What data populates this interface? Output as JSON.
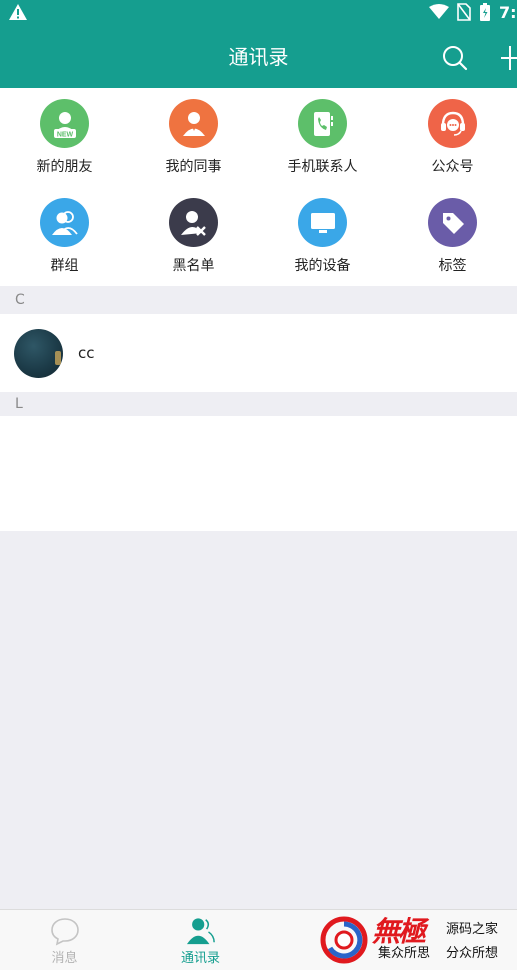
{
  "status_bar": {
    "time": "7:",
    "icons": [
      "warning-icon",
      "wifi-icon",
      "no-sim-icon",
      "battery-icon"
    ]
  },
  "header": {
    "title": "通讯录",
    "background": "#159e8f",
    "actions": [
      "search-icon",
      "plus-icon"
    ]
  },
  "features": [
    {
      "label": "新的朋友",
      "icon": "new-friend-icon",
      "color": "#5dbf6a",
      "badge": "NEW"
    },
    {
      "label": "我的同事",
      "icon": "colleague-icon",
      "color": "#ef7340"
    },
    {
      "label": "手机联系人",
      "icon": "phone-contacts-icon",
      "color": "#5dbf6a"
    },
    {
      "label": "公众号",
      "icon": "public-account-icon",
      "color": "#ef6448"
    },
    {
      "label": "群组",
      "icon": "group-icon",
      "color": "#3aa7e8"
    },
    {
      "label": "黑名单",
      "icon": "blacklist-icon",
      "color": "#3b3b4b"
    },
    {
      "label": "我的设备",
      "icon": "device-icon",
      "color": "#3aa7e8"
    },
    {
      "label": "标签",
      "icon": "tag-icon",
      "color": "#6a5ca8"
    }
  ],
  "sections": [
    {
      "letter": "C",
      "contacts": [
        {
          "name": "cc"
        }
      ]
    },
    {
      "letter": "L",
      "contacts": []
    }
  ],
  "bottom_nav": {
    "active_color": "#159e8f",
    "tabs": [
      {
        "label": "消息",
        "icon": "chat-bubble-icon",
        "active": false
      },
      {
        "label": "通讯录",
        "icon": "contacts-icon",
        "active": true
      }
    ]
  },
  "watermark": {
    "brand": "無極",
    "line1": "源码之家",
    "line2": "集众所思",
    "line3": "分众所想"
  }
}
